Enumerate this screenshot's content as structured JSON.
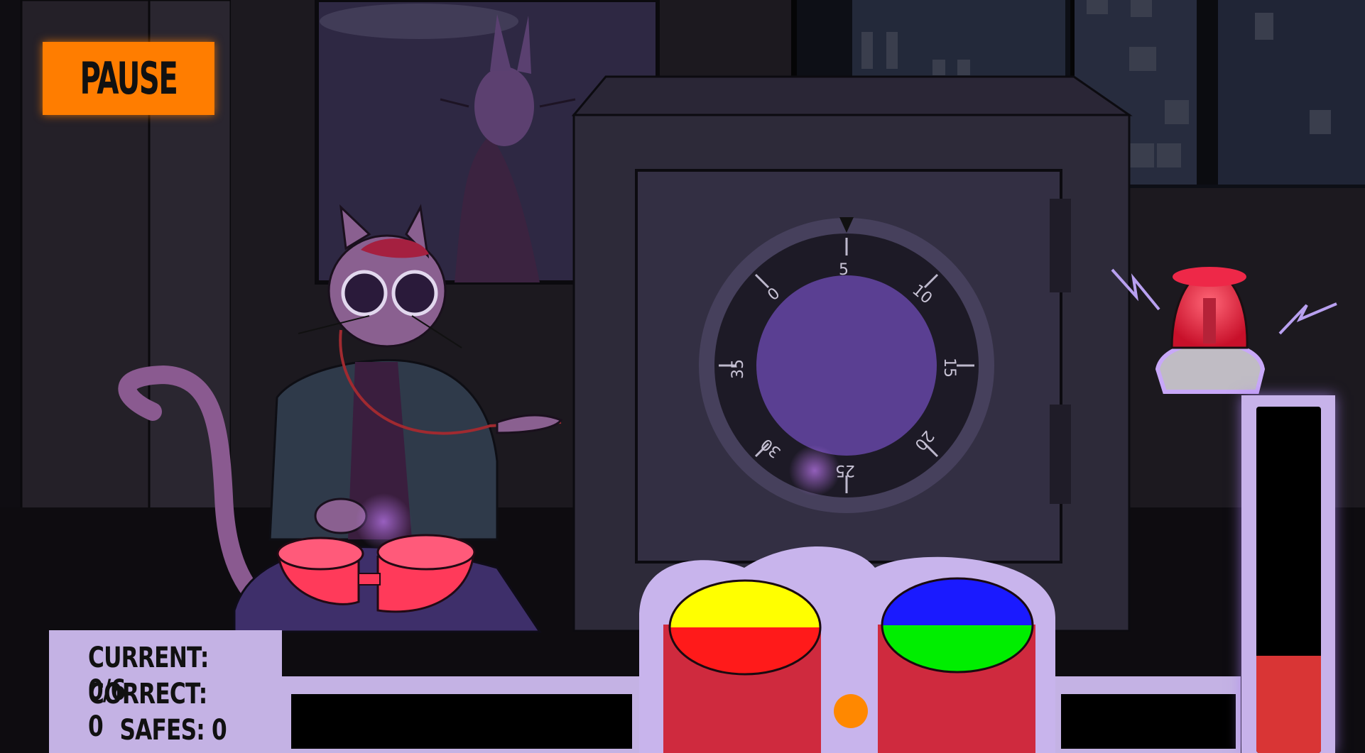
{
  "pause_button": {
    "label": "PAUSE"
  },
  "hud": {
    "current_label": "CURRENT: 0/6",
    "correct_label": "CORRECT: 0",
    "safes_label": "SAFES: 0"
  },
  "dial": {
    "numbers": [
      "5",
      "10",
      "15",
      "20",
      "25",
      "30",
      "35",
      "0"
    ]
  },
  "buttons": {
    "left": {
      "top_color": "#ffff00",
      "bottom_color": "#ff1a1a"
    },
    "right": {
      "top_color": "#1a1aff",
      "bottom_color": "#00ee00"
    }
  },
  "alarm_meter": {
    "level": 0.28,
    "fill_color": "#d93535"
  },
  "colors": {
    "pause_orange": "#ff7d00",
    "panel_lavender": "#c4b2e4",
    "alarm_red": "#e03040"
  }
}
